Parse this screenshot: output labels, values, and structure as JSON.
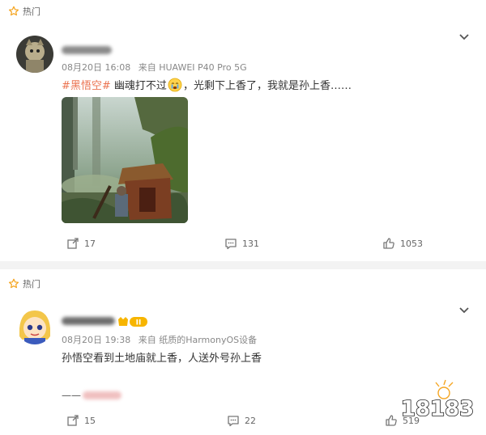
{
  "posts": [
    {
      "hot_label": "热门",
      "meta": {
        "date": "08月20日 16:08",
        "source": "来自 HUAWEI P40 Pro 5G"
      },
      "text": {
        "tag": "#黑悟空#",
        "before_emoji": " 幽魂打不过",
        "after_emoji": "，光剩下上香了，我就是孙上香……"
      },
      "actions": {
        "repost": "17",
        "comment": "131",
        "like": "1053"
      }
    },
    {
      "hot_label": "热门",
      "meta": {
        "date": "08月20日 19:38",
        "source": "来自 纸质的HarmonyOS设备"
      },
      "badge": "II",
      "text": "孙悟空看到土地庙就上香，人送外号孙上香",
      "signature_prefix": "——",
      "actions": {
        "repost": "15",
        "comment": "22",
        "like": "519"
      }
    }
  ],
  "watermark": "18183",
  "colors": {
    "tag": "#eb7350",
    "hot_star": "#f5a623",
    "badge": "#f7b500"
  }
}
